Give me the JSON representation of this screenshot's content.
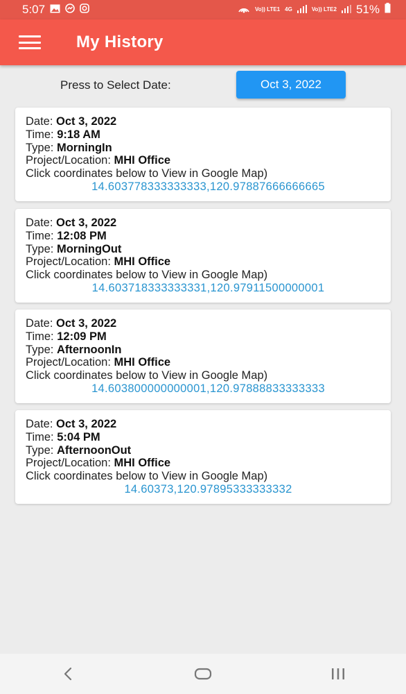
{
  "status_bar": {
    "time": "5:07",
    "battery": "51%",
    "net1": "Vo)) LTE1",
    "net2": "4G",
    "net3": "Vo)) LTE2"
  },
  "app_bar": {
    "title": "My History"
  },
  "date_picker": {
    "label": "Press to Select Date:",
    "value": "Oct 3, 2022"
  },
  "labels": {
    "date": "Date: ",
    "time": "Time: ",
    "type": "Type: ",
    "location": "Project/Location: ",
    "hint": "Click coordinates below to View in Google Map)"
  },
  "entries": [
    {
      "date": "Oct 3, 2022",
      "time": "9:18 AM",
      "type": "MorningIn",
      "location": "MHI Office",
      "coords": "14.603778333333333,120.97887666666665"
    },
    {
      "date": "Oct 3, 2022",
      "time": "12:08 PM",
      "type": "MorningOut",
      "location": "MHI Office",
      "coords": "14.603718333333331,120.97911500000001"
    },
    {
      "date": "Oct 3, 2022",
      "time": "12:09 PM",
      "type": "AfternoonIn",
      "location": "MHI Office",
      "coords": "14.603800000000001,120.97888833333333"
    },
    {
      "date": "Oct 3, 2022",
      "time": "5:04 PM",
      "type": "AfternoonOut",
      "location": "MHI Office",
      "coords": "14.60373,120.97895333333332"
    }
  ]
}
